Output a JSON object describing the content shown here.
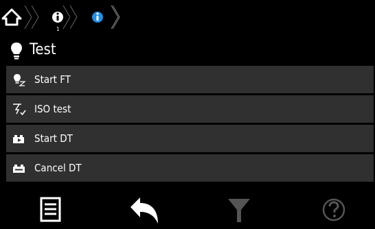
{
  "breadcrumb": {
    "items": [
      {
        "icon": "home-icon"
      },
      {
        "icon": "info-icon",
        "index": "1",
        "color": "#ffffff"
      },
      {
        "icon": "info-icon",
        "color": "#1e90e6"
      }
    ]
  },
  "page": {
    "title": "Test",
    "title_icon": "lightbulb-icon"
  },
  "menu": {
    "items": [
      {
        "label": "Start FT",
        "icon": "ft-icon"
      },
      {
        "label": "ISO test",
        "icon": "iso-icon"
      },
      {
        "label": "Start DT",
        "icon": "dt-start-icon"
      },
      {
        "label": "Cancel DT",
        "icon": "dt-cancel-icon"
      }
    ]
  },
  "footer": {
    "buttons": [
      {
        "name": "list-menu-button",
        "icon": "list-icon",
        "enabled": true
      },
      {
        "name": "back-button",
        "icon": "back-arrow-icon",
        "enabled": true
      },
      {
        "name": "filter-button",
        "icon": "filter-icon",
        "enabled": false
      },
      {
        "name": "help-button",
        "icon": "help-icon",
        "enabled": false
      }
    ]
  },
  "colors": {
    "background": "#000000",
    "menu_item_bg": "#303030",
    "accent_blue": "#1e90e6",
    "disabled_gray": "#555555"
  }
}
